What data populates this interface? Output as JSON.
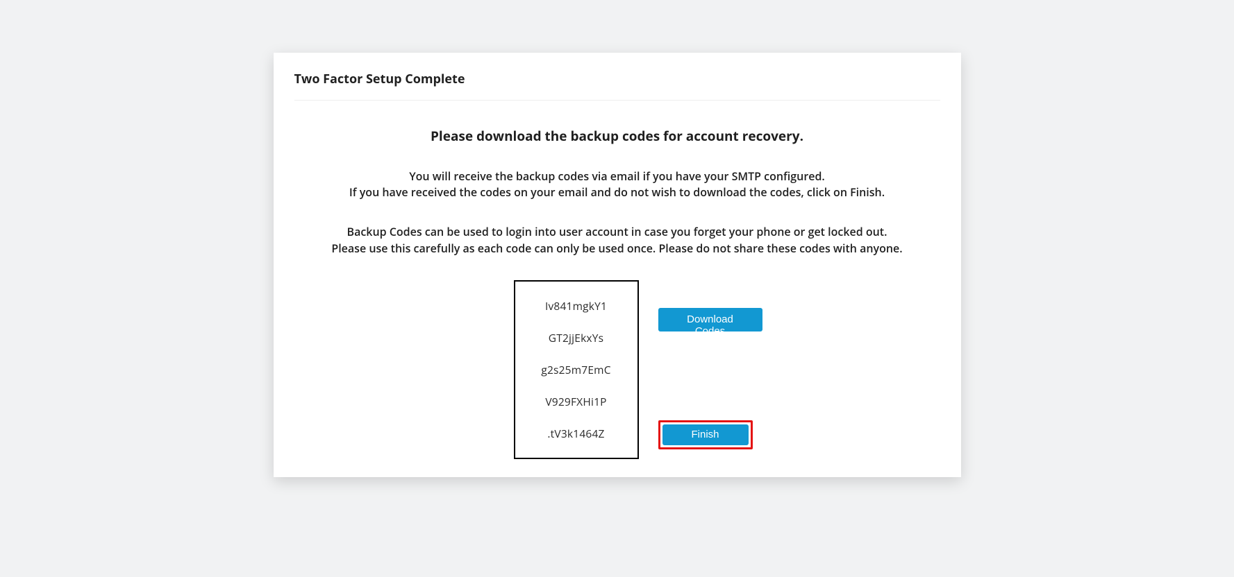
{
  "card": {
    "title": "Two Factor Setup Complete"
  },
  "content": {
    "heading": "Please download the backup codes for account recovery.",
    "para1_line1": "You will receive the backup codes via email if you have your SMTP configured.",
    "para1_line2": "If you have received the codes on your email and do not wish to download the codes, click on Finish.",
    "para2_line1": "Backup Codes can be used to login into user account in case you forget your phone or get locked out.",
    "para2_line2": "Please use this carefully as each code can only be used once. Please do not share these codes with anyone."
  },
  "codes": {
    "c0": "Iv841mgkY1",
    "c1": "GT2jjEkxYs",
    "c2": "g2s25m7EmC",
    "c3": "V929FXHi1P",
    "c4": ".tV3k1464Z"
  },
  "actions": {
    "download": "Download Codes",
    "finish": "Finish"
  }
}
